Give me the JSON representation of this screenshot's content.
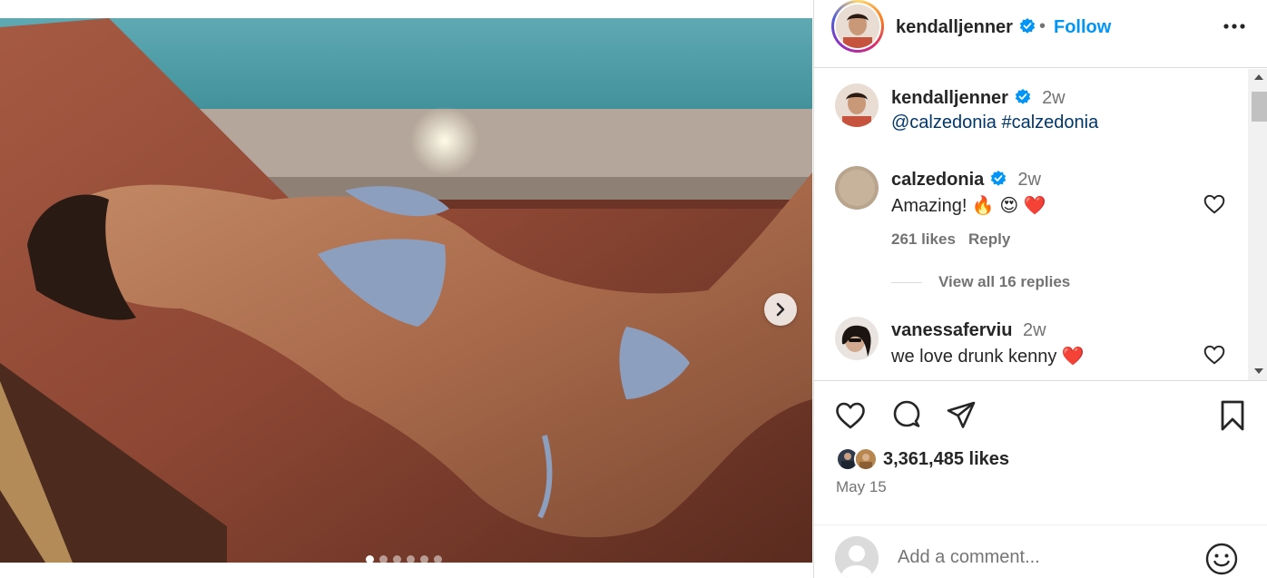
{
  "post": {
    "author": "kendalljenner",
    "follow_label": "Follow",
    "separator": "•",
    "caption": {
      "author": "kendalljenner",
      "time": "2w",
      "text": "@calzedonia #calzedonia"
    },
    "carousel": {
      "slide_count": 6,
      "active_index": 0
    },
    "likes_label": "3,361,485 likes",
    "date": "May 15"
  },
  "comments": [
    {
      "author": "calzedonia",
      "verified": true,
      "time": "2w",
      "text": "Amazing! 🔥 😍 ❤️",
      "likes": "261 likes",
      "reply_label": "Reply",
      "view_replies": "View all 16 replies"
    },
    {
      "author": "vanessaferviu",
      "verified": false,
      "time": "2w",
      "text": "we love drunk kenny ❤️"
    }
  ],
  "add_comment": {
    "placeholder": "Add a comment..."
  },
  "colors": {
    "accent": "#0095f6",
    "verified": "#0095f6",
    "link": "#00376b",
    "heart_red": "#ed4956"
  },
  "icons": [
    "more-options-icon",
    "heart-icon",
    "comment-icon",
    "share-icon",
    "bookmark-icon",
    "emoji-icon",
    "chevron-right-icon",
    "verified-badge-icon"
  ]
}
